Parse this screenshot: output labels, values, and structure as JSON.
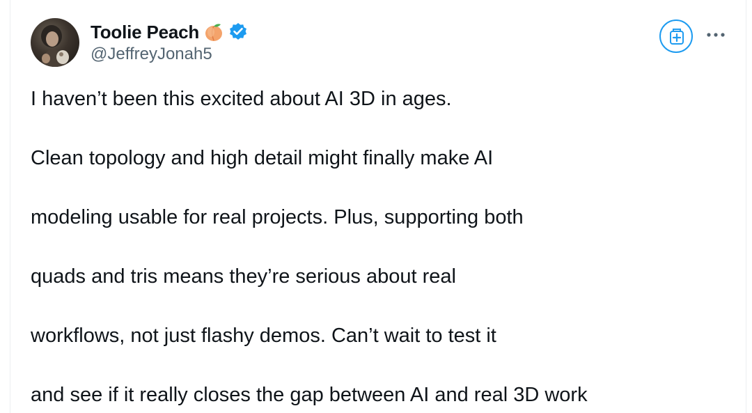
{
  "post": {
    "author": {
      "display_name": "Toolie Peach",
      "handle": "@JeffreyJonah5",
      "name_emoji_icon": "peach-icon",
      "verified_icon": "verified-badge-icon",
      "avatar": "avatar"
    },
    "actions": {
      "grok_icon": "grok-icon",
      "more_icon": "more-dots-icon"
    },
    "text_lines": [
      "I haven’t been this excited about AI 3D in ages.",
      "Clean topology and high detail might finally make AI",
      "modeling usable for real projects. Plus, supporting both",
      "quads and tris means they’re serious about real",
      "workflows, not just flashy demos. Can’t wait to test it",
      "and see if it really closes the gap between AI and real 3D work"
    ]
  },
  "colors": {
    "text_primary": "#0f1419",
    "text_secondary": "#536471",
    "accent_blue": "#1d9bf0",
    "verified_blue": "#1d9bf0"
  }
}
